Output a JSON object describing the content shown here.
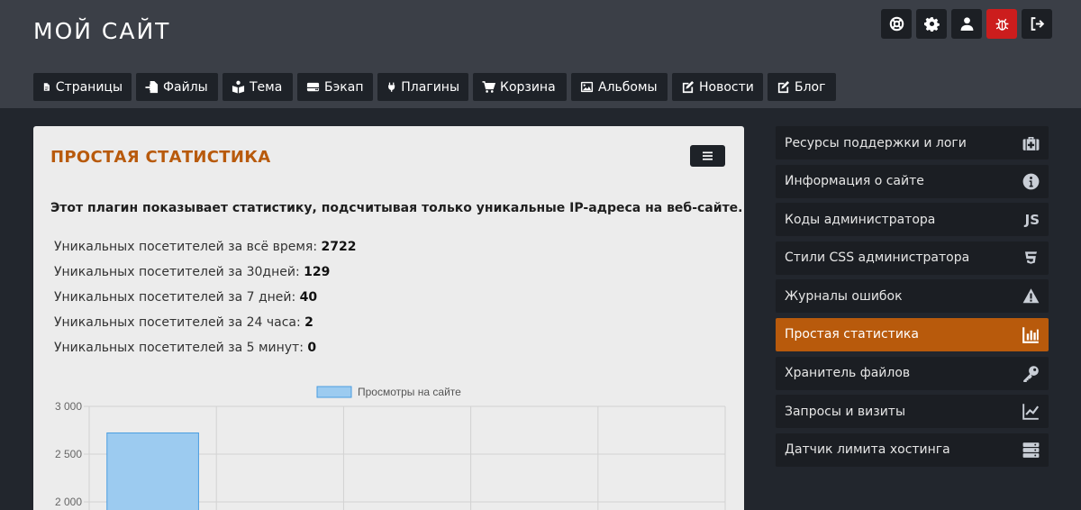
{
  "header": {
    "site_title": "МОЙ САЙТ"
  },
  "top_icons": [
    {
      "icon": "lifebuoy-icon"
    },
    {
      "icon": "gear-icon"
    },
    {
      "icon": "user-icon"
    },
    {
      "icon": "bug-icon",
      "color": "#cc1d1d"
    },
    {
      "icon": "sign-out-icon"
    }
  ],
  "nav": {
    "items": [
      {
        "label": "Страницы",
        "icon": "file-icon"
      },
      {
        "label": "Файлы",
        "icon": "file-import-icon"
      },
      {
        "label": "Тема",
        "icon": "book-reader-icon"
      },
      {
        "label": "Бэкап",
        "icon": "hdd-icon"
      },
      {
        "label": "Плагины",
        "icon": "plug-icon"
      },
      {
        "label": "Корзина",
        "icon": "shopping-cart-icon"
      },
      {
        "label": "Альбомы",
        "icon": "image-icon"
      },
      {
        "label": "Новости",
        "icon": "edit-icon"
      },
      {
        "label": "Блог",
        "icon": "edit-icon"
      }
    ]
  },
  "card": {
    "title": "ПРОСТАЯ СТАТИСТИКА",
    "description": "Этот плагин показывает статистику, подсчитывая только уникальные IP-адреса на веб-сайте.",
    "stats": [
      {
        "label": "Уникальных посетителей за всё время:",
        "value": "2722"
      },
      {
        "label": "Уникальных посетителей за 30дней:",
        "value": "129"
      },
      {
        "label": "Уникальных посетителей за 7 дней:",
        "value": "40"
      },
      {
        "label": "Уникальных посетителей за 24 часа:",
        "value": "2"
      },
      {
        "label": "Уникальных посетителей за 5 минут:",
        "value": "0"
      }
    ]
  },
  "chart_data": {
    "type": "bar",
    "legend": [
      "Просмотры на сайте"
    ],
    "series": [
      {
        "name": "Просмотры на сайте",
        "values": [
          2722
        ]
      }
    ],
    "y_ticks": [
      "3 000",
      "2 500",
      "2 000"
    ],
    "ylim_visible": [
      2000,
      3000
    ],
    "bar_color": "#9ccbf0",
    "bar_border": "#4a9de0",
    "grid": true,
    "legend_position": "top"
  },
  "sidebar": {
    "items": [
      {
        "label": "Ресурсы поддержки и логи",
        "icon": "medkit-icon",
        "active": false
      },
      {
        "label": "Информация о сайте",
        "icon": "info-circle-icon",
        "active": false
      },
      {
        "label": "Коды администратора",
        "icon": "js-icon",
        "active": false
      },
      {
        "label": "Стили CSS администратора",
        "icon": "css3-icon",
        "active": false
      },
      {
        "label": "Журналы ошибок",
        "icon": "warning-icon",
        "active": false
      },
      {
        "label": "Простая статистика",
        "icon": "chart-bar-icon",
        "active": true
      },
      {
        "label": "Хранитель файлов",
        "icon": "key-icon",
        "active": false
      },
      {
        "label": "Запросы и визиты",
        "icon": "chart-line-icon",
        "active": false
      },
      {
        "label": "Датчик лимита хостинга",
        "icon": "server-icon",
        "active": false
      }
    ],
    "js_glyph": "JS"
  },
  "colors": {
    "accent": "#b85a0c",
    "header_bg": "#3b3f47",
    "page_bg": "#22262d"
  }
}
